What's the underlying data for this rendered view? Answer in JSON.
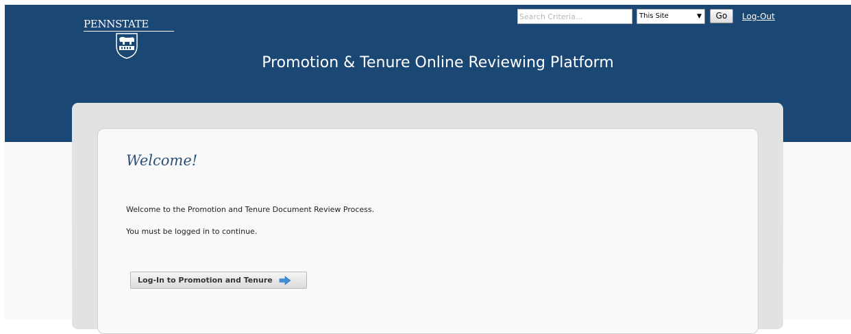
{
  "header": {
    "logo_text": "PENNSTATE",
    "title": "Promotion & Tenure Online Reviewing Platform",
    "search": {
      "placeholder": "Search Criteria...",
      "value": ""
    },
    "scope_select": {
      "selected": "This Site"
    },
    "go_label": "Go",
    "logout_label": "Log-Out"
  },
  "main": {
    "heading": "Welcome!",
    "intro_text": "Welcome to the Promotion and Tenure Document Review Process.",
    "login_required_text": "You must be logged in to continue.",
    "login_button_label": "Log-In to Promotion and Tenure"
  },
  "colors": {
    "header_bg": "#1b4774",
    "heading_text": "#2a4f79",
    "arrow_icon": "#3f8fd9"
  },
  "icons": {
    "login_button": "arrow-right-icon",
    "scope_select": "chevron-down-icon",
    "logo": "nittany-lion-shield-icon"
  }
}
